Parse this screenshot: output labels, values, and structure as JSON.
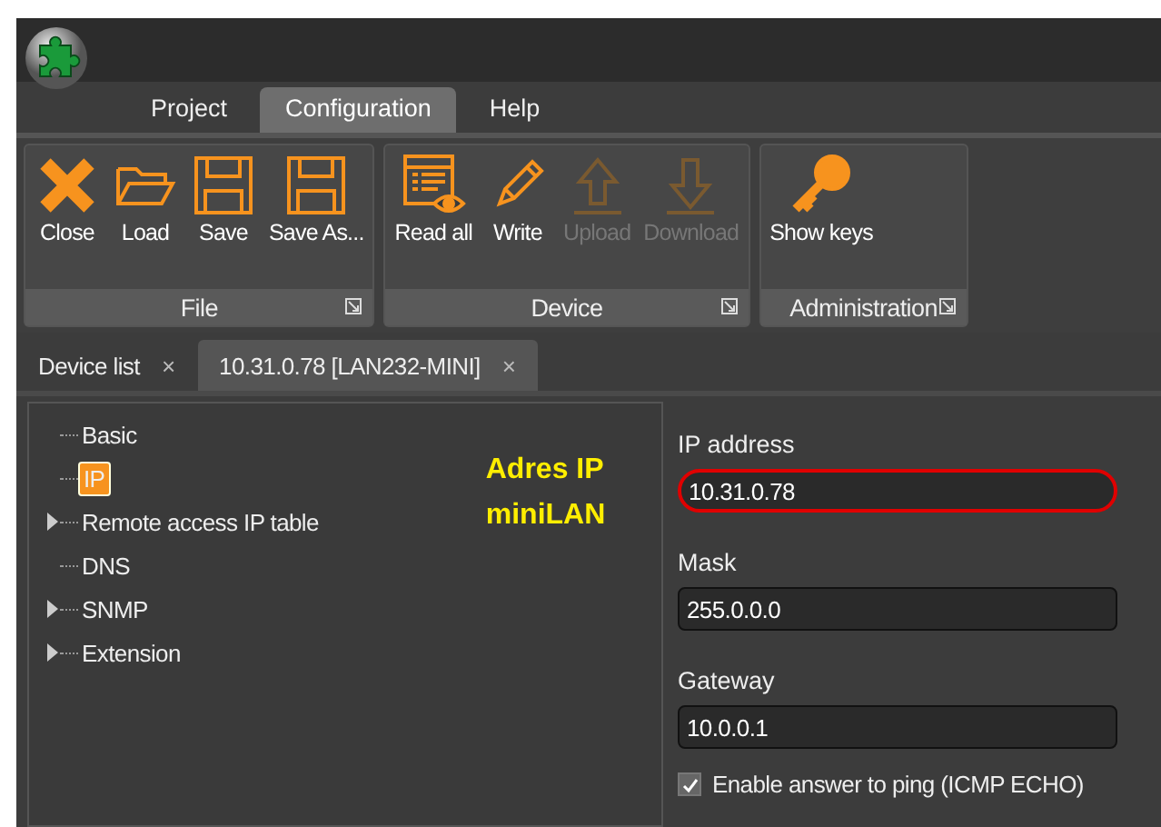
{
  "menu": [
    {
      "label": "Project",
      "selected": false
    },
    {
      "label": "Configuration",
      "selected": true
    },
    {
      "label": "Help",
      "selected": false
    }
  ],
  "ribbon": [
    {
      "label": "File",
      "buttons": [
        {
          "label": "Close",
          "kind": "close",
          "disabled": false
        },
        {
          "label": "Load",
          "kind": "open",
          "disabled": false
        },
        {
          "label": "Save",
          "kind": "save",
          "disabled": false
        },
        {
          "label": "Save As...",
          "kind": "save",
          "disabled": false
        }
      ]
    },
    {
      "label": "Device",
      "buttons": [
        {
          "label": "Read all",
          "kind": "read",
          "disabled": false
        },
        {
          "label": "Write",
          "kind": "write",
          "disabled": false
        },
        {
          "label": "Upload",
          "kind": "upload",
          "disabled": true
        },
        {
          "label": "Download",
          "kind": "download",
          "disabled": true
        }
      ]
    },
    {
      "label": "Administration",
      "buttons": [
        {
          "label": "Show keys",
          "kind": "key",
          "disabled": false
        }
      ]
    }
  ],
  "doc_tabs": [
    {
      "label": "Device list",
      "selected": false,
      "close": "×"
    },
    {
      "label": "10.31.0.78 [LAN232-MINI]",
      "selected": true,
      "close": "×"
    }
  ],
  "tree": [
    {
      "label": "Basic",
      "selected": false,
      "expandable": false
    },
    {
      "label": "IP",
      "selected": true,
      "expandable": false
    },
    {
      "label": "Remote access IP table",
      "selected": false,
      "expandable": true
    },
    {
      "label": "DNS",
      "selected": false,
      "expandable": false
    },
    {
      "label": "SNMP",
      "selected": false,
      "expandable": true
    },
    {
      "label": "Extension",
      "selected": false,
      "expandable": true
    }
  ],
  "annotation": "Adres IP miniLAN",
  "fields": [
    {
      "label": "IP address",
      "value": "10.31.0.78",
      "highlighted": true
    },
    {
      "label": "Mask",
      "value": "255.0.0.0",
      "highlighted": false
    },
    {
      "label": "Gateway",
      "value": "10.0.0.1",
      "highlighted": false
    }
  ],
  "ping": {
    "label": "Enable answer to ping (ICMP ECHO)",
    "checked": true
  }
}
